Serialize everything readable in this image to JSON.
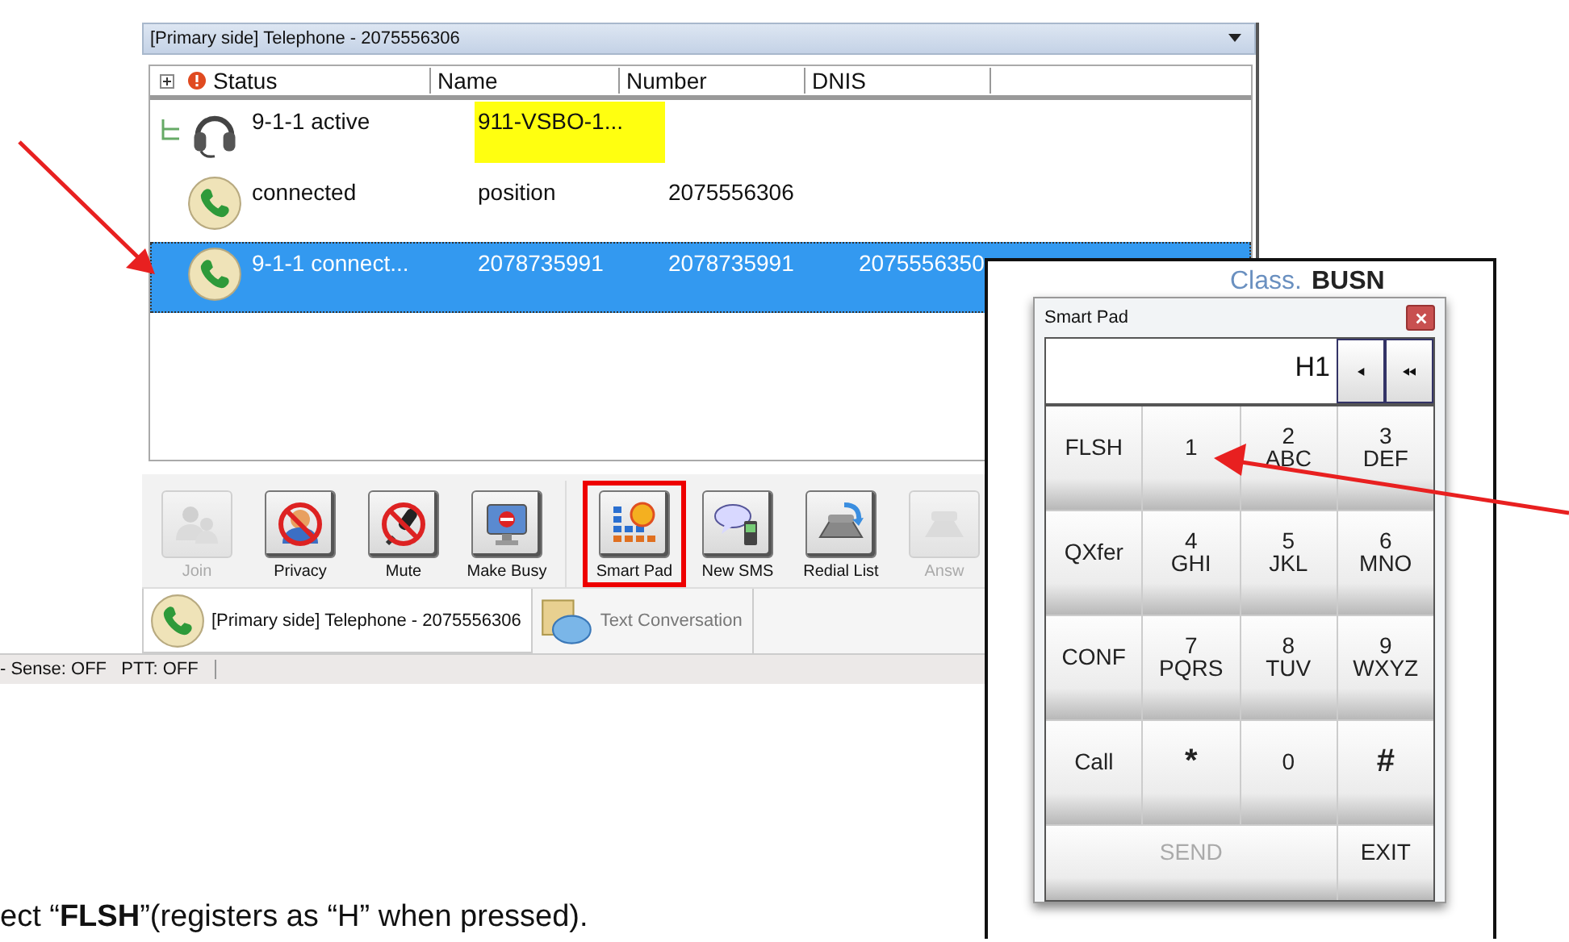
{
  "window": {
    "title": "[Primary side] Telephone - 2075556306"
  },
  "table": {
    "columns": [
      "Status",
      "Name",
      "Number",
      "DNIS"
    ],
    "rows": [
      {
        "kind": "group",
        "expanded": true,
        "status": "9-1-1 active",
        "name": "911-VSBO-1...",
        "number": "",
        "dnis": "",
        "highlight": true,
        "selected": false
      },
      {
        "kind": "call",
        "status": "connected",
        "name": "position",
        "number": "2075556306",
        "dnis": "",
        "highlight": false,
        "selected": false
      },
      {
        "kind": "call",
        "status": "9-1-1  connect...",
        "name": "2078735991",
        "number": "2078735991",
        "dnis": "2075556350",
        "highlight": false,
        "selected": true
      }
    ]
  },
  "toolbar": [
    {
      "label": "Join",
      "disabled": true,
      "marked": false
    },
    {
      "label": "Privacy",
      "disabled": false,
      "marked": false
    },
    {
      "label": "Mute",
      "disabled": false,
      "marked": false
    },
    {
      "label": "Make Busy",
      "disabled": false,
      "marked": false
    },
    {
      "label": "Smart Pad",
      "disabled": false,
      "marked": true
    },
    {
      "label": "New SMS",
      "disabled": false,
      "marked": false
    },
    {
      "label": "Redial List",
      "disabled": false,
      "marked": false
    },
    {
      "label": "Answ",
      "disabled": true,
      "marked": false
    }
  ],
  "tabs": [
    {
      "label": "[Primary side] Telephone - 2075556306",
      "selected": true
    },
    {
      "label": "Text Conversation",
      "selected": false
    }
  ],
  "status_bar": "- Sense: OFF   PTT: OFF",
  "behind_pad": [
    "Class.",
    "BUSN"
  ],
  "smart_pad": {
    "title": "Smart Pad",
    "display": "H1",
    "keys": [
      {
        "kind": "key",
        "main": "FLSH",
        "disabled": false
      },
      {
        "kind": "key",
        "main": "1",
        "disabled": false
      },
      {
        "kind": "key",
        "main": "2",
        "sub": "ABC",
        "disabled": false
      },
      {
        "kind": "key",
        "main": "3",
        "sub": "DEF",
        "disabled": false
      },
      {
        "kind": "key",
        "main": "QXfer",
        "disabled": false
      },
      {
        "kind": "key",
        "main": "4",
        "sub": "GHI",
        "disabled": false
      },
      {
        "kind": "key",
        "main": "5",
        "sub": "JKL",
        "disabled": false
      },
      {
        "kind": "key",
        "main": "6",
        "sub": "MNO",
        "disabled": false
      },
      {
        "kind": "key",
        "main": "CONF",
        "disabled": false
      },
      {
        "kind": "key",
        "main": "7",
        "sub": "PQRS",
        "disabled": false
      },
      {
        "kind": "key",
        "main": "8",
        "sub": "TUV",
        "disabled": false
      },
      {
        "kind": "key",
        "main": "9",
        "sub": "WXYZ",
        "disabled": false
      },
      {
        "kind": "key",
        "main": "Call",
        "disabled": false
      },
      {
        "kind": "key",
        "main": "*",
        "disabled": false
      },
      {
        "kind": "key",
        "main": "0",
        "disabled": false
      },
      {
        "kind": "key",
        "main": "#",
        "disabled": false
      },
      {
        "kind": "wide",
        "main": "SEND",
        "disabled": true
      },
      {
        "kind": "key",
        "main": "EXIT",
        "disabled": false
      }
    ]
  },
  "caption": "ect “**FLSH**”(registers as “H” when pressed)."
}
